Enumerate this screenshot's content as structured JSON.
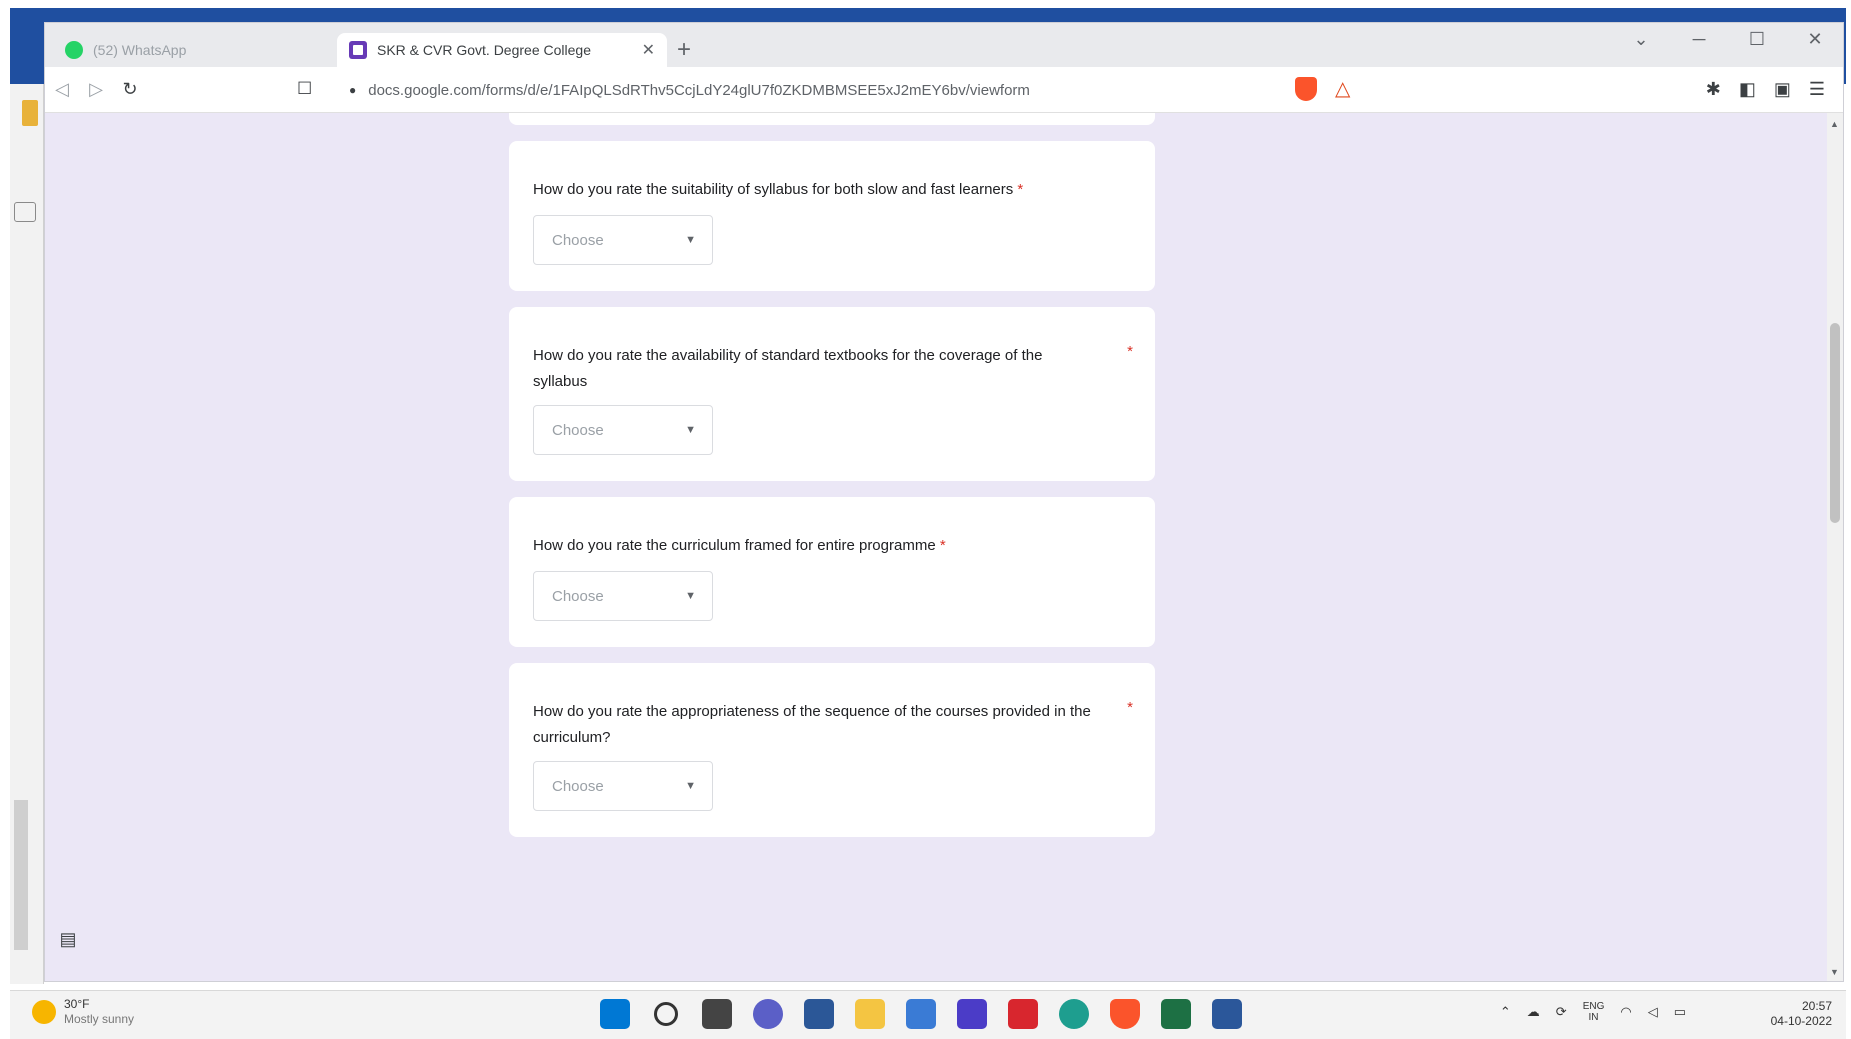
{
  "browser": {
    "tabs": [
      {
        "title": "(52) WhatsApp",
        "icon": "whatsapp-icon",
        "active": false
      },
      {
        "title": "SKR & CVR Govt. Degree College",
        "icon": "google-forms-icon",
        "active": true
      }
    ],
    "url": "docs.google.com/forms/d/e/1FAIpQLSdRThv5CcjLdY24glU7f0ZKDMBMSEE5xJ2mEY6bv/viewform",
    "window_controls": [
      "minimize",
      "maximize",
      "close"
    ]
  },
  "form": {
    "questions": [
      {
        "text": "How do you rate the suitability of syllabus for both slow and fast learners",
        "required": "*",
        "placeholder": "Choose"
      },
      {
        "text": "How do you rate the availability of standard textbooks for the coverage of the syllabus",
        "required": "*",
        "placeholder": "Choose"
      },
      {
        "text": "How do  you rate the curriculum framed for entire programme",
        "required": "*",
        "placeholder": "Choose"
      },
      {
        "text": "How do you rate the appropriateness of the sequence of the courses provided in the curriculum?",
        "required": "*",
        "placeholder": "Choose"
      }
    ]
  },
  "taskbar": {
    "weather": {
      "temp": "30°F",
      "condition": "Mostly sunny"
    },
    "tray": {
      "lang_top": "ENG",
      "lang_bottom": "IN"
    },
    "clock": {
      "time": "20:57",
      "date": "04-10-2022"
    }
  },
  "colors": {
    "page_background": "#ebe7f6",
    "forms_accent": "#673ab7",
    "required_red": "#d93025"
  }
}
